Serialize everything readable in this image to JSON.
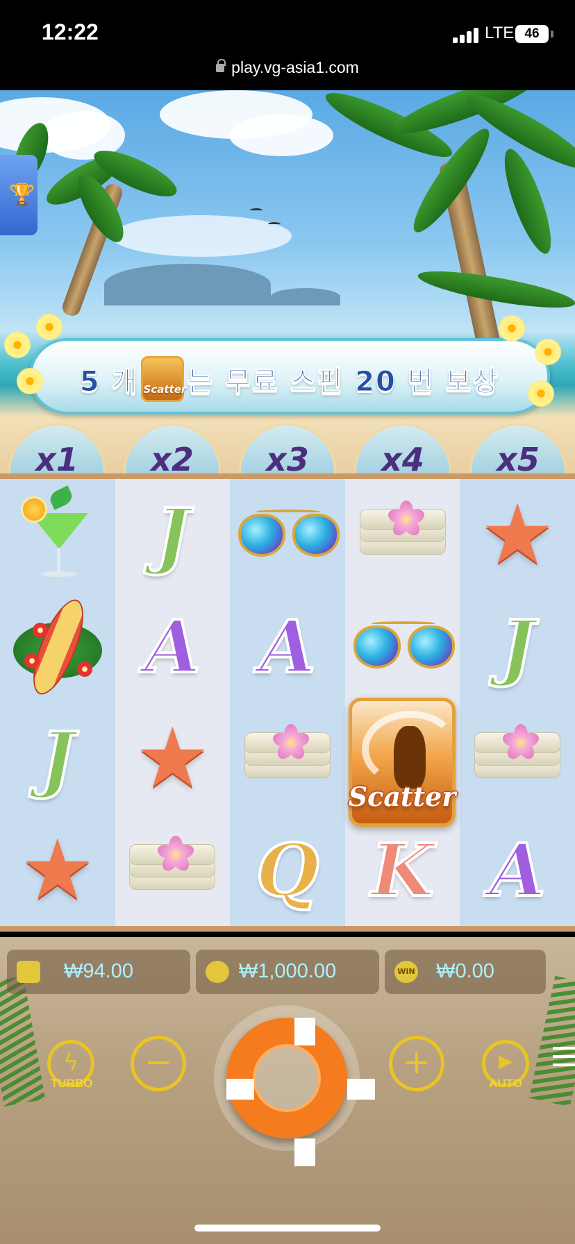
{
  "status_bar": {
    "time": "12:22",
    "network": "LTE",
    "battery": "46",
    "url": "play.vg-asia1.com"
  },
  "banner": {
    "text_before": "5 개",
    "scatter_badge": "Scatter",
    "text_after": "는 무료 스핀 20 번 보상"
  },
  "multipliers": [
    "x1",
    "x2",
    "x3",
    "x4",
    "x5"
  ],
  "reels": [
    [
      "cocktail",
      "surfboard",
      "J",
      "starfish"
    ],
    [
      "J",
      "A",
      "starfish",
      "towel"
    ],
    [
      "sunglasses",
      "A",
      "towel",
      "Q"
    ],
    [
      "towel",
      "sunglasses",
      "scatter",
      "K"
    ],
    [
      "starfish",
      "J",
      "towel",
      "A"
    ]
  ],
  "scatter_label": "Scatter",
  "info_bar": {
    "balance": "₩94.00",
    "bet": "₩1,000.00",
    "win": "₩0.00",
    "win_icon": "WIN"
  },
  "controls": {
    "turbo": "TURBO",
    "auto": "AUTO"
  },
  "icons": {
    "trophy": "trophy-icon",
    "wallet": "wallet-icon",
    "coins": "coins-icon",
    "menu": "menu-icon"
  }
}
